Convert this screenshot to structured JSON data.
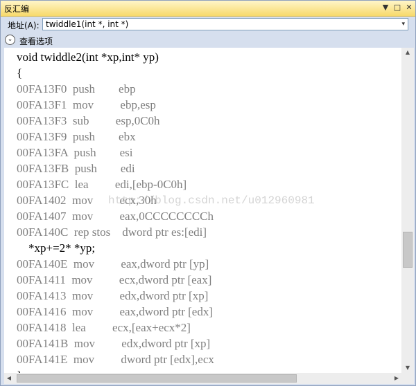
{
  "window": {
    "title": "反汇编"
  },
  "titlebar_buttons": {
    "dropdown": "▼",
    "maximize": "□",
    "close": "✕"
  },
  "address": {
    "label": "地址(A):",
    "value": "twiddle1(int *, int *)",
    "dropdown_glyph": "▾"
  },
  "options": {
    "toggle_glyph": "⌄",
    "label": "查看选项"
  },
  "code_lines": [
    {
      "text": "void twiddle2(int *xp,int* yp)",
      "kind": "src"
    },
    {
      "text": "{",
      "kind": "src"
    },
    {
      "text": "00FA13F0  push        ebp",
      "kind": "asm"
    },
    {
      "text": "00FA13F1  mov         ebp,esp",
      "kind": "asm"
    },
    {
      "text": "00FA13F3  sub         esp,0C0h",
      "kind": "asm"
    },
    {
      "text": "00FA13F9  push        ebx",
      "kind": "asm"
    },
    {
      "text": "00FA13FA  push        esi",
      "kind": "asm"
    },
    {
      "text": "00FA13FB  push        edi",
      "kind": "asm"
    },
    {
      "text": "00FA13FC  lea         edi,[ebp-0C0h]",
      "kind": "asm"
    },
    {
      "text": "00FA1402  mov         ecx,30h",
      "kind": "asm"
    },
    {
      "text": "00FA1407  mov         eax,0CCCCCCCCh",
      "kind": "asm"
    },
    {
      "text": "00FA140C  rep stos    dword ptr es:[edi]",
      "kind": "asm"
    },
    {
      "text": "    *xp+=2* *yp;",
      "kind": "src"
    },
    {
      "text": "00FA140E  mov         eax,dword ptr [yp]",
      "kind": "asm"
    },
    {
      "text": "00FA1411  mov         ecx,dword ptr [eax]",
      "kind": "asm"
    },
    {
      "text": "00FA1413  mov         edx,dword ptr [xp]",
      "kind": "asm"
    },
    {
      "text": "00FA1416  mov         eax,dword ptr [edx]",
      "kind": "asm"
    },
    {
      "text": "00FA1418  lea         ecx,[eax+ecx*2]",
      "kind": "asm"
    },
    {
      "text": "00FA141B  mov         edx,dword ptr [xp]",
      "kind": "asm"
    },
    {
      "text": "00FA141E  mov         dword ptr [edx],ecx",
      "kind": "asm"
    },
    {
      "text": "}",
      "kind": "src"
    }
  ],
  "watermark": "http://blog.csdn.net/u012960981",
  "scrollbars": {
    "up": "▲",
    "down": "▼",
    "left": "◀",
    "right": "▶"
  }
}
